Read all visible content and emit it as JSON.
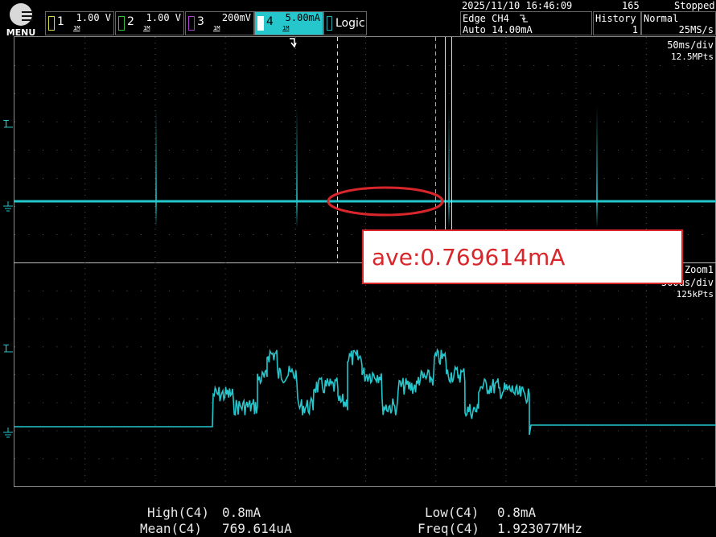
{
  "menu": {
    "label": "MENU",
    "icon": "hamburger-icon"
  },
  "channels": [
    {
      "num": "1",
      "scale": "1.00 V",
      "coupling": "1M",
      "color": "#d8d84a",
      "active": false
    },
    {
      "num": "2",
      "scale": "1.00 V",
      "coupling": "1M",
      "color": "#3fbf3f",
      "active": false
    },
    {
      "num": "3",
      "scale": "200mV",
      "coupling": "1M",
      "color": "#b040d0",
      "active": false
    },
    {
      "num": "4",
      "scale": "5.00mA",
      "coupling": "1M",
      "color": "#25c6cc",
      "active": true
    }
  ],
  "logic": {
    "label": "Logic"
  },
  "status": {
    "datetime": "2025/11/10 16:46:09",
    "trigger_line1": "Edge CH4",
    "trigger_slope_icon": "falling-edge-icon",
    "trigger_line2": "Auto 14.00mA",
    "count": "165",
    "state": "Stopped",
    "history_label": "History",
    "history_value": "1",
    "mode": "Normal",
    "sample_rate": "25MS/s"
  },
  "main_window": {
    "timebase": "50ms/div",
    "points": "12.5MPts",
    "trace_color": "#25c6cc"
  },
  "zoom_window": {
    "label": "Zoom1",
    "timebase": "500us/div",
    "points": "125kPts"
  },
  "annotation": {
    "text": "ave:0.769614mA",
    "color": "#d9262b"
  },
  "measurements": {
    "high_label": "High(C4)",
    "high_value": "0.8mA",
    "mean_label": "Mean(C4)",
    "mean_value": "769.614uA",
    "low_label": "Low(C4)",
    "low_value": "0.8mA",
    "freq_label": "Freq(C4)",
    "freq_value": "1.923077MHz"
  }
}
